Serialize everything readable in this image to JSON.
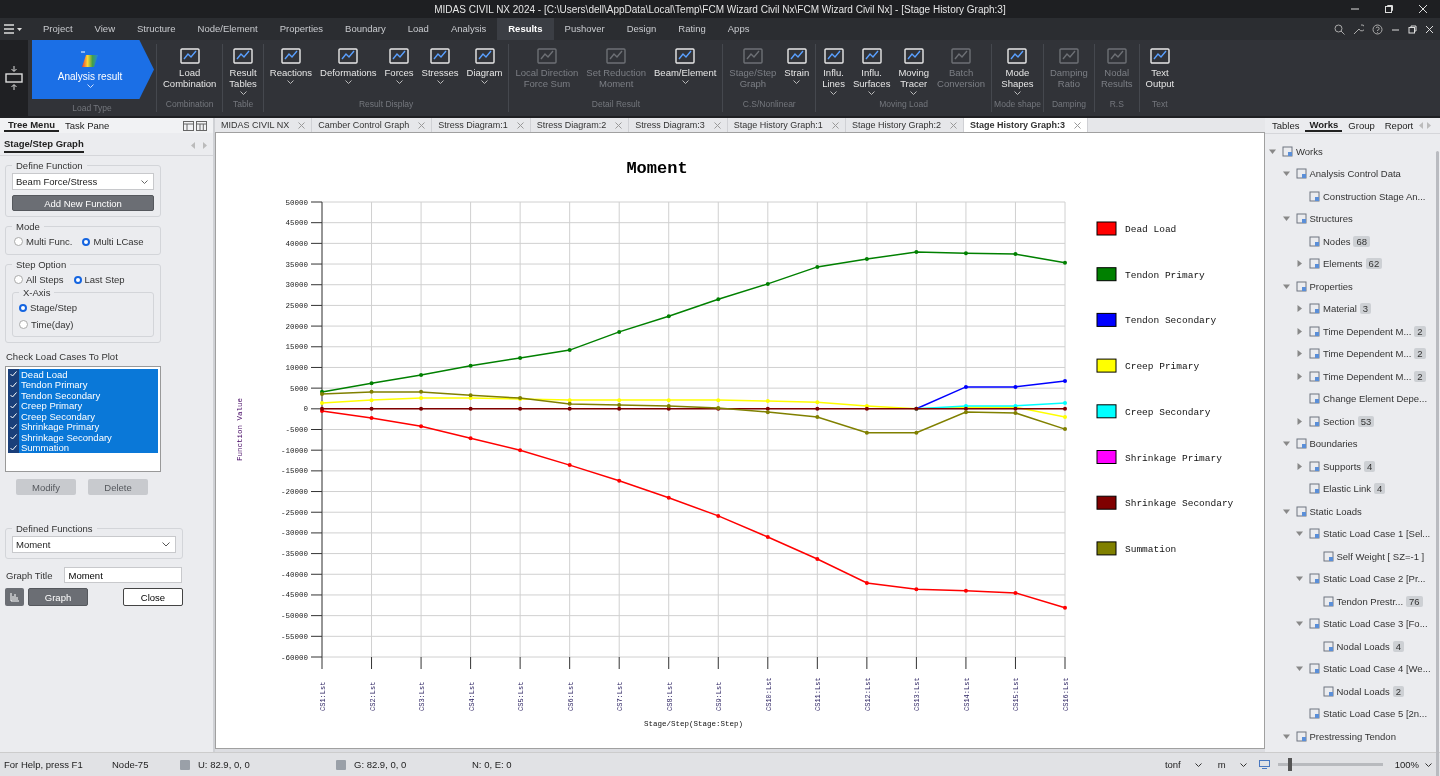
{
  "window": {
    "title": "MIDAS CIVIL NX 2024 - [C:\\Users\\dell\\AppData\\Local\\Temp\\FCM Wizard Civil Nx\\FCM Wizard Civil Nx] - [Stage History Graph:3]"
  },
  "menu": [
    {
      "label": "Project",
      "selected": false
    },
    {
      "label": "View",
      "selected": false
    },
    {
      "label": "Structure",
      "selected": false
    },
    {
      "label": "Node/Element",
      "selected": false
    },
    {
      "label": "Properties",
      "selected": false
    },
    {
      "label": "Boundary",
      "selected": false
    },
    {
      "label": "Load",
      "selected": false
    },
    {
      "label": "Analysis",
      "selected": false
    },
    {
      "label": "Results",
      "selected": true
    },
    {
      "label": "Pushover",
      "selected": false
    },
    {
      "label": "Design",
      "selected": false
    },
    {
      "label": "Rating",
      "selected": false
    },
    {
      "label": "Apps",
      "selected": false
    }
  ],
  "ribbon": {
    "load_type": {
      "label": "Analysis result",
      "group": "Load Type"
    },
    "groups": [
      {
        "label": "Combination",
        "buttons": [
          {
            "label": "Load\nCombination",
            "disabled": false,
            "dropdown": false
          }
        ]
      },
      {
        "label": "Table",
        "buttons": [
          {
            "label": "Result\nTables",
            "disabled": false,
            "dropdown": true
          }
        ]
      },
      {
        "label": "Result Display",
        "buttons": [
          {
            "label": "Reactions",
            "disabled": false,
            "dropdown": true
          },
          {
            "label": "Deformations",
            "disabled": false,
            "dropdown": true
          },
          {
            "label": "Forces",
            "disabled": false,
            "dropdown": true
          },
          {
            "label": "Stresses",
            "disabled": false,
            "dropdown": true
          },
          {
            "label": "Diagram",
            "disabled": false,
            "dropdown": true
          }
        ]
      },
      {
        "label": "Detail Result",
        "buttons": [
          {
            "label": "Local Direction\nForce Sum",
            "disabled": true,
            "dropdown": false
          },
          {
            "label": "Set Reduction\nMoment",
            "disabled": true,
            "dropdown": false
          },
          {
            "label": "Beam/Element",
            "disabled": false,
            "dropdown": true
          }
        ]
      },
      {
        "label": "C.S/Nonlinear",
        "buttons": [
          {
            "label": "Stage/Step\nGraph",
            "disabled": true,
            "dropdown": false
          },
          {
            "label": "Strain",
            "disabled": false,
            "dropdown": true
          }
        ]
      },
      {
        "label": "Moving Load",
        "buttons": [
          {
            "label": "Influ.\nLines",
            "disabled": false,
            "dropdown": true
          },
          {
            "label": "Influ.\nSurfaces",
            "disabled": false,
            "dropdown": true
          },
          {
            "label": "Moving\nTracer",
            "disabled": false,
            "dropdown": true
          },
          {
            "label": "Batch\nConversion",
            "disabled": true,
            "dropdown": false
          }
        ]
      },
      {
        "label": "Mode shape",
        "buttons": [
          {
            "label": "Mode\nShapes",
            "disabled": false,
            "dropdown": true
          }
        ]
      },
      {
        "label": "Damping",
        "buttons": [
          {
            "label": "Damping\nRatio",
            "disabled": true,
            "dropdown": false
          }
        ]
      },
      {
        "label": "R.S",
        "buttons": [
          {
            "label": "Nodal\nResults",
            "disabled": true,
            "dropdown": false
          }
        ]
      },
      {
        "label": "Text",
        "buttons": [
          {
            "label": "Text\nOutput",
            "disabled": false,
            "dropdown": false
          }
        ]
      }
    ]
  },
  "left_panel": {
    "tabs": [
      {
        "label": "Tree Menu",
        "selected": true
      },
      {
        "label": "Task Pane",
        "selected": false
      }
    ],
    "subtab": "Stage/Step Graph",
    "define_function": {
      "title": "Define Function",
      "value": "Beam Force/Stress",
      "button": "Add New Function"
    },
    "mode": {
      "title": "Mode",
      "options": [
        {
          "label": "Multi Func.",
          "selected": false
        },
        {
          "label": "Multi LCase",
          "selected": true
        }
      ]
    },
    "step_option": {
      "title": "Step Option",
      "options": [
        {
          "label": "All Steps",
          "selected": false
        },
        {
          "label": "Last Step",
          "selected": true
        }
      ],
      "x_axis": {
        "title": "X-Axis",
        "options": [
          {
            "label": "Stage/Step",
            "selected": true
          },
          {
            "label": "Time(day)",
            "selected": false
          }
        ]
      }
    },
    "load_cases_title": "Check Load Cases To Plot",
    "load_cases": [
      {
        "label": "Dead Load",
        "checked": true,
        "selected": true
      },
      {
        "label": "Tendon Primary",
        "checked": true,
        "selected": true
      },
      {
        "label": "Tendon Secondary",
        "checked": true,
        "selected": true
      },
      {
        "label": "Creep Primary",
        "checked": true,
        "selected": true
      },
      {
        "label": "Creep Secondary",
        "checked": true,
        "selected": true
      },
      {
        "label": "Shrinkage Primary",
        "checked": true,
        "selected": true
      },
      {
        "label": "Shrinkage Secondary",
        "checked": true,
        "selected": true
      },
      {
        "label": "Summation",
        "checked": true,
        "selected": true
      }
    ],
    "list_buttons": [
      {
        "label": "Modify",
        "disabled": true
      },
      {
        "label": "Delete",
        "disabled": true
      }
    ],
    "defined_functions": {
      "title": "Defined Functions",
      "value": "Moment"
    },
    "graph_title": {
      "label": "Graph Title",
      "value": "Moment"
    },
    "graph_button": "Graph",
    "close_button": "Close"
  },
  "doc_tabs": [
    {
      "label": "MIDAS CIVIL NX",
      "selected": false
    },
    {
      "label": "Camber Control Graph",
      "selected": false
    },
    {
      "label": "Stress Diagram:1",
      "selected": false
    },
    {
      "label": "Stress Diagram:2",
      "selected": false
    },
    {
      "label": "Stress Diagram:3",
      "selected": false
    },
    {
      "label": "Stage History Graph:1",
      "selected": false
    },
    {
      "label": "Stage History Graph:2",
      "selected": false
    },
    {
      "label": "Stage History Graph:3",
      "selected": true
    }
  ],
  "chart": {
    "chart_data": {
      "type": "line",
      "title": "Moment",
      "xlabel": "Stage/Step(Stage:Step)",
      "ylabel": "Function Value",
      "categories": [
        "CS1:Lst",
        "CS2:Lst",
        "CS3:Lst",
        "CS4:Lst",
        "CS5:Lst",
        "CS6:Lst",
        "CS7:Lst",
        "CS8:Lst",
        "CS9:Lst",
        "CS10:Lst",
        "CS11:Lst",
        "CS12:Lst",
        "CS13:Lst",
        "CS14:Lst",
        "CS15:Lst",
        "CS16:Lst"
      ],
      "ylim": [
        -60000,
        50000
      ],
      "grid": true,
      "legend": true,
      "yticks": [
        -60000,
        -55000,
        -50000,
        -45000,
        -40000,
        -35000,
        -30000,
        -25000,
        -20000,
        -15000,
        -10000,
        -5000,
        0,
        5000,
        10000,
        15000,
        20000,
        25000,
        30000,
        35000,
        40000,
        45000,
        50000
      ],
      "series": [
        {
          "name": "Dead Load",
          "color": "#ff0000",
          "values": [
            -500,
            -2200,
            -4200,
            -7100,
            -10000,
            -13600,
            -17400,
            -21500,
            -25900,
            -31000,
            -36300,
            -42100,
            -43600,
            -44000,
            -44500,
            -48100
          ]
        },
        {
          "name": "Tendon Primary",
          "color": "#008000",
          "values": [
            4100,
            6200,
            8200,
            10400,
            12300,
            14200,
            18600,
            22400,
            26500,
            30200,
            34300,
            36200,
            37900,
            37600,
            37400,
            35300
          ]
        },
        {
          "name": "Tendon Secondary",
          "color": "#0000ff",
          "values": [
            null,
            null,
            null,
            null,
            null,
            null,
            null,
            null,
            null,
            null,
            null,
            null,
            0,
            5300,
            5300,
            6700
          ]
        },
        {
          "name": "Creep Primary",
          "color": "#ffff00",
          "values": [
            1400,
            2100,
            2600,
            2600,
            2400,
            2100,
            2100,
            2100,
            2100,
            1900,
            1600,
            700,
            0,
            400,
            400,
            -2000
          ]
        },
        {
          "name": "Creep Secondary",
          "color": "#00ffff",
          "values": [
            null,
            null,
            null,
            null,
            null,
            null,
            null,
            null,
            null,
            null,
            null,
            null,
            0,
            700,
            700,
            1400
          ]
        },
        {
          "name": "Shrinkage Primary",
          "color": "#ff00ff",
          "values": [
            null,
            null,
            null,
            null,
            null,
            null,
            null,
            null,
            null,
            null,
            null,
            null,
            null,
            null,
            null,
            null
          ]
        },
        {
          "name": "Shrinkage Secondary",
          "color": "#800000",
          "values": [
            0,
            0,
            0,
            0,
            0,
            0,
            0,
            0,
            0,
            0,
            0,
            0,
            0,
            0,
            0,
            0
          ]
        },
        {
          "name": "Summation",
          "color": "#808000",
          "values": [
            3600,
            4100,
            4100,
            3300,
            2600,
            1200,
            900,
            700,
            200,
            -800,
            -2000,
            -5800,
            -5800,
            -800,
            -1000,
            -4900
          ]
        }
      ]
    }
  },
  "right_panel": {
    "tabs": [
      {
        "label": "Tables",
        "selected": false
      },
      {
        "label": "Works",
        "selected": true
      },
      {
        "label": "Group",
        "selected": false
      },
      {
        "label": "Report",
        "selected": false
      }
    ],
    "tree": [
      {
        "label": "Works",
        "expanded": true,
        "children": [
          {
            "label": "Analysis Control Data",
            "expanded": true,
            "children": [
              {
                "label": "Construction Stage An..."
              }
            ]
          },
          {
            "label": "Structures",
            "expanded": true,
            "children": [
              {
                "label": "Nodes",
                "count": "68"
              },
              {
                "label": "Elements",
                "count": "62",
                "expanded": false
              }
            ]
          },
          {
            "label": "Properties",
            "expanded": true,
            "children": [
              {
                "label": "Material",
                "count": "3",
                "expanded": false
              },
              {
                "label": "Time Dependent M...",
                "count": "2",
                "expanded": false
              },
              {
                "label": "Time Dependent M...",
                "count": "2",
                "expanded": false
              },
              {
                "label": "Time Dependent M...",
                "count": "2",
                "expanded": false
              },
              {
                "label": "Change Element Depe..."
              },
              {
                "label": "Section",
                "count": "53",
                "expanded": false
              }
            ]
          },
          {
            "label": "Boundaries",
            "expanded": true,
            "children": [
              {
                "label": "Supports",
                "count": "4",
                "expanded": false
              },
              {
                "label": "Elastic Link",
                "count": "4"
              }
            ]
          },
          {
            "label": "Static Loads",
            "expanded": true,
            "children": [
              {
                "label": "Static Load Case 1 [Sel...",
                "expanded": true,
                "children": [
                  {
                    "label": "Self Weight [ SZ=-1 ]"
                  }
                ]
              },
              {
                "label": "Static Load Case 2 [Pr...",
                "expanded": true,
                "children": [
                  {
                    "label": "Tendon Prestr...",
                    "count": "76"
                  }
                ]
              },
              {
                "label": "Static Load Case 3 [Fo...",
                "expanded": true,
                "children": [
                  {
                    "label": "Nodal Loads",
                    "count": "4"
                  }
                ]
              },
              {
                "label": "Static Load Case 4 [We...",
                "expanded": true,
                "children": [
                  {
                    "label": "Nodal Loads",
                    "count": "2"
                  }
                ]
              },
              {
                "label": "Static Load Case 5 [2n..."
              }
            ]
          },
          {
            "label": "Prestressing Tendon",
            "expanded": true
          }
        ]
      }
    ]
  },
  "status_bar": {
    "help": "For Help, press F1",
    "node": "Node-75",
    "u": "U: 82.9, 0, 0",
    "g": "G: 82.9, 0, 0",
    "ne": "N: 0, E: 0",
    "force_unit": "tonf",
    "length_unit": "m",
    "zoom": {
      "level": 0.1
    },
    "zoom_text": "100%"
  }
}
